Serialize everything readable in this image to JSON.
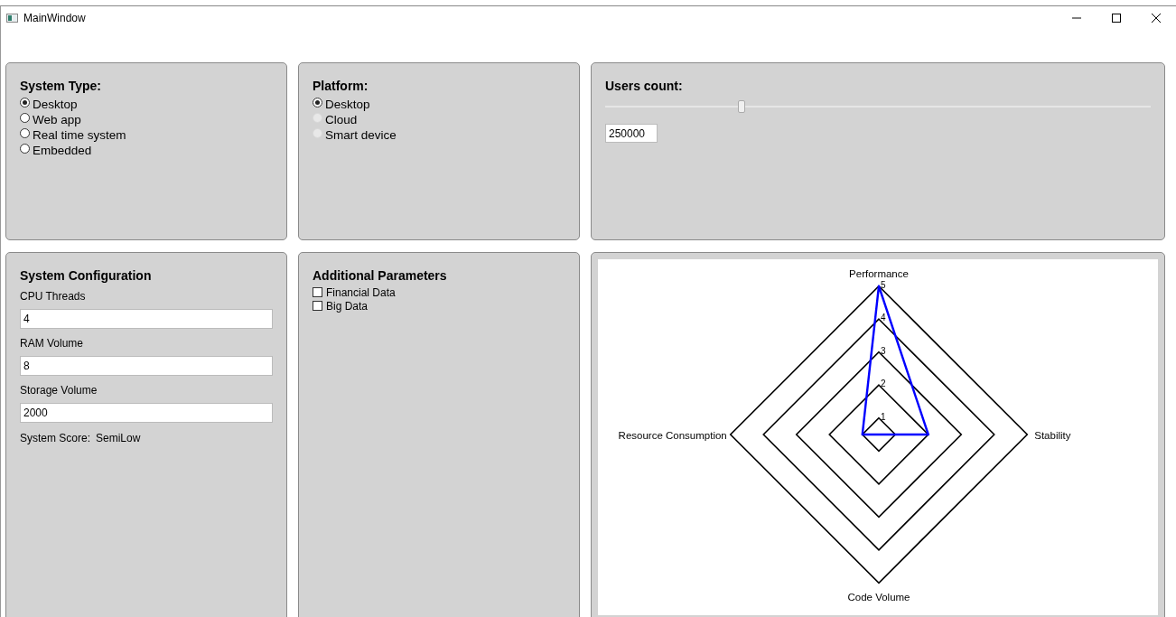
{
  "window": {
    "title": "MainWindow"
  },
  "system_type": {
    "title": "System Type:",
    "options": [
      {
        "label": "Desktop",
        "selected": true,
        "disabled": false
      },
      {
        "label": "Web app",
        "selected": false,
        "disabled": false
      },
      {
        "label": "Real time system",
        "selected": false,
        "disabled": false
      },
      {
        "label": "Embedded",
        "selected": false,
        "disabled": false
      }
    ]
  },
  "platform": {
    "title": "Platform:",
    "options": [
      {
        "label": "Desktop",
        "selected": true,
        "disabled": false
      },
      {
        "label": "Cloud",
        "selected": false,
        "disabled": true
      },
      {
        "label": "Smart device",
        "selected": false,
        "disabled": true
      }
    ]
  },
  "users_count": {
    "title": "Users count:",
    "slider": {
      "level": 0.25
    },
    "value": "250000"
  },
  "system_configuration": {
    "title": "System Configuration",
    "fields": [
      {
        "label": "CPU Threads",
        "value": "4"
      },
      {
        "label": "RAM Volume",
        "value": "8"
      },
      {
        "label": "Storage Volume",
        "value": "2000"
      }
    ],
    "score_label": "System Score:",
    "score_value": "SemiLow"
  },
  "additional_parameters": {
    "title": "Additional Parameters",
    "options": [
      {
        "label": "Financial Data",
        "checked": false
      },
      {
        "label": "Big Data",
        "checked": false
      }
    ]
  },
  "radar": {
    "axes": [
      "Performance",
      "Stability",
      "Code Volume",
      "Resource Consumption"
    ],
    "ring_labels": [
      "5",
      "4",
      "3",
      "2",
      "1"
    ]
  }
}
